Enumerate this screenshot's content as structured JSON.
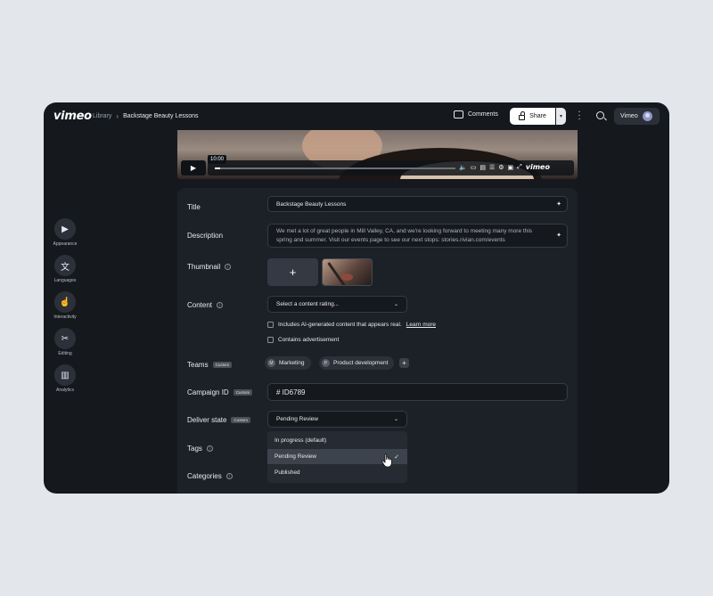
{
  "header": {
    "logo": "vimeo",
    "breadcrumb_library": "Library",
    "breadcrumb_separator": "›",
    "breadcrumb_current": "Backstage Beauty Lessons",
    "comments_label": "Comments",
    "share_label": "Share",
    "user_label": "Vimeo"
  },
  "rail": {
    "items": [
      {
        "label": "Appearance",
        "icon": "play-square-icon"
      },
      {
        "label": "Languages",
        "icon": "translate-icon"
      },
      {
        "label": "Interactivity",
        "icon": "pointer-icon"
      },
      {
        "label": "Editing",
        "icon": "scissors-icon"
      },
      {
        "label": "Analytics",
        "icon": "chart-icon"
      }
    ]
  },
  "video": {
    "time_tooltip": "10:00",
    "logo": "vimeo"
  },
  "form": {
    "title_label": "Title",
    "title_value": "Backstage Beauty Lessons",
    "description_label": "Description",
    "description_value": "We met a lot of great people in Mill Valley, CA, and we're looking forward to meeting many more this spring and summer. Visit our events page to see our next stops: stories.rivian.com/events",
    "thumbnail_label": "Thumbnail",
    "thumbnail_add": "+",
    "content_label": "Content",
    "content_select": "Select a content rating...",
    "ai_check_text": "Includes AI-generated content that appears real.",
    "ai_check_link": "Learn more",
    "ads_check_text": "Contains advertisement",
    "teams_label": "Teams",
    "custom_badge": "Custom",
    "teams": [
      {
        "initial": "M",
        "name": "Marketing"
      },
      {
        "initial": "P",
        "name": "Product development"
      }
    ],
    "add_team": "+",
    "campaign_label": "Campaign ID",
    "campaign_value": "# ID6789",
    "deliver_label": "Deliver state",
    "deliver_value": "Pending Review",
    "deliver_options": [
      "In progress (default)",
      "Pending Review",
      "Published"
    ],
    "tags_label": "Tags",
    "categories_label": "Categories"
  }
}
